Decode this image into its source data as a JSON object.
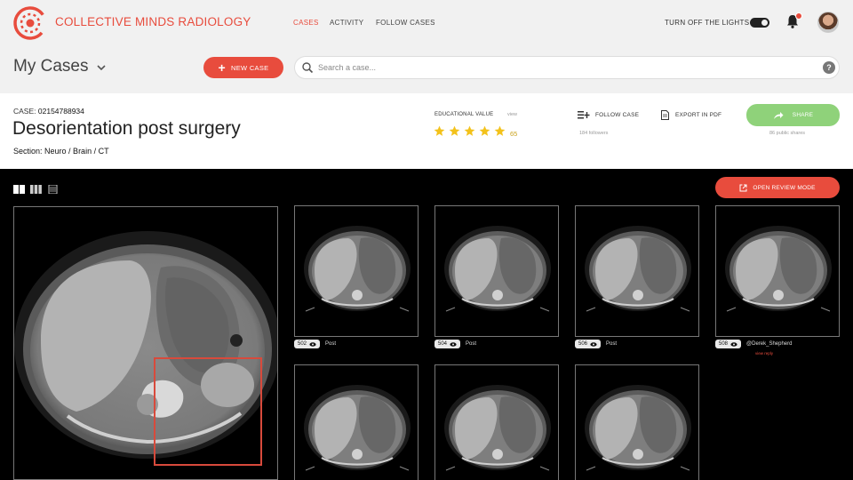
{
  "brand": {
    "name": "COLLECTIVE MINDS RADIOLOGY",
    "color": "#e84c3d"
  },
  "nav": [
    {
      "label": "CASES",
      "active": true
    },
    {
      "label": "ACTIVITY",
      "active": false
    },
    {
      "label": "FOLLOW CASES",
      "active": false
    }
  ],
  "lights_label": "TURN OFF THE LIGHTS",
  "header": {
    "title": "My Cases",
    "new_case_label": "NEW CASE",
    "search_placeholder": "Search a case...",
    "help_icon": "?"
  },
  "case": {
    "id_label": "CASE:",
    "id": "02154788934",
    "title": "Desorientation post surgery",
    "section_label": "Section:",
    "section": "Neuro / Brain / CT",
    "educational_value_label": "EDUCATIONAL VALUE",
    "educational_view": "view",
    "rating": 5,
    "rating_score": "65",
    "follow_label": "FOLLOW CASE",
    "followers": "184 followers",
    "export_label": "EXPORT IN PDF",
    "share_label": "SHARE",
    "shares": "86 public shares"
  },
  "viewer": {
    "open_review_label": "OPEN REVIEW MODE",
    "thumbs": [
      {
        "num": "502",
        "comment": "Post"
      },
      {
        "num": "504",
        "comment": "Post"
      },
      {
        "num": "506",
        "comment": "Post"
      },
      {
        "num": "508",
        "comment": "@Derek_Shepherd",
        "reply": "view reply"
      },
      {
        "num": "",
        "comment": ""
      },
      {
        "num": "",
        "comment": ""
      },
      {
        "num": "",
        "comment": ""
      }
    ]
  },
  "colors": {
    "accent": "#e84c3d",
    "share": "#8fd27a",
    "star": "#f3c21b"
  }
}
